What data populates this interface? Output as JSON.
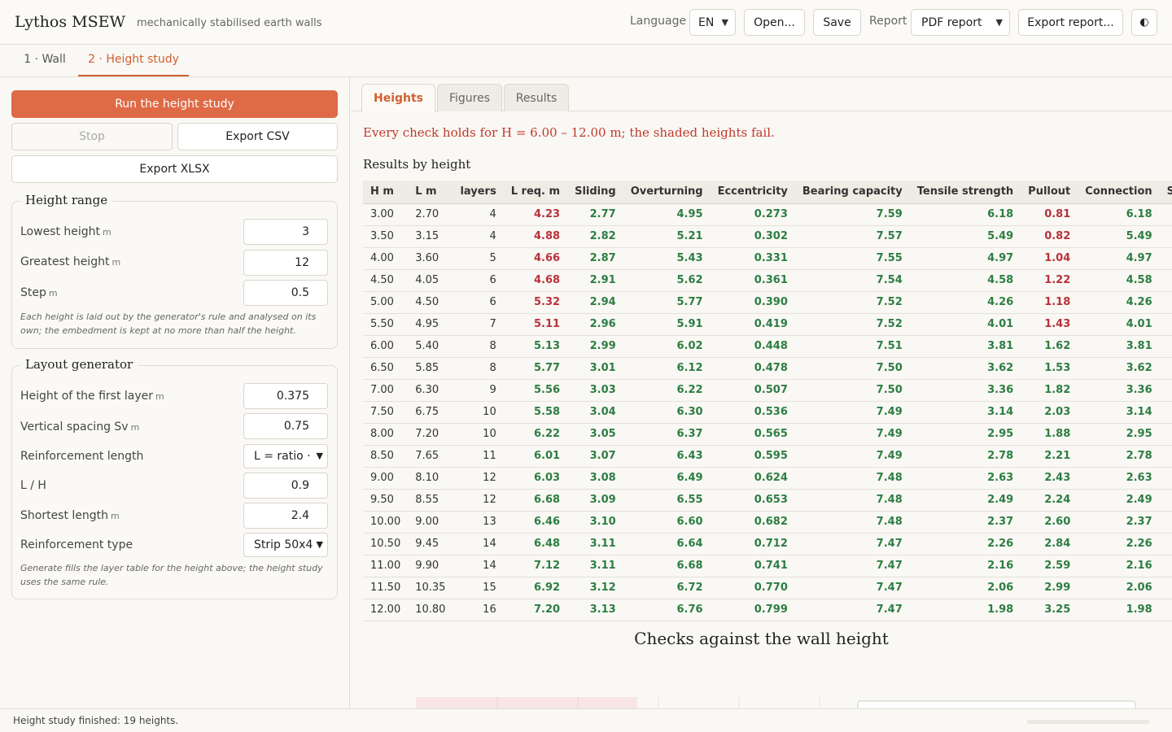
{
  "app": {
    "title": "Lythos MSEW",
    "subtitle": "mechanically stabilised earth walls"
  },
  "toolbar": {
    "language_label": "Language",
    "language_value": "EN",
    "open_label": "Open...",
    "save_label": "Save",
    "report_label": "Report",
    "report_value": "PDF report",
    "export_report_label": "Export report...",
    "theme_icon": "◐"
  },
  "steps": [
    {
      "label": "1 · Wall"
    },
    {
      "label": "2 · Height study"
    }
  ],
  "sidebar": {
    "run_label": "Run the height study",
    "stop_label": "Stop",
    "export_csv_label": "Export CSV",
    "export_xlsx_label": "Export XLSX",
    "height_range": {
      "legend": "Height range",
      "lowest_label": "Lowest height",
      "lowest_value": "3",
      "greatest_label": "Greatest height",
      "greatest_value": "12",
      "step_label": "Step",
      "step_value": "0.5",
      "unit": "m",
      "note": "Each height is laid out by the generator's rule and analysed on its own; the embedment is kept at no more than half the height."
    },
    "layout_generator": {
      "legend": "Layout generator",
      "first_layer_label": "Height of the first layer",
      "first_layer_value": "0.375",
      "spacing_label": "Vertical spacing Sv",
      "spacing_value": "0.75",
      "length_label": "Reinforcement length",
      "length_value": "L = ratio ·",
      "ratio_label": "L / H",
      "ratio_value": "0.9",
      "shortest_label": "Shortest length",
      "shortest_value": "2.4",
      "type_label": "Reinforcement type",
      "type_value": "Strip 50x4",
      "unit": "m",
      "note": "Generate fills the layer table for the height above; the height study uses the same rule."
    }
  },
  "main": {
    "tabs": [
      {
        "label": "Heights"
      },
      {
        "label": "Figures"
      },
      {
        "label": "Results"
      }
    ],
    "banner": "Every check holds for H = 6.00 – 12.00 m; the shaded heights fail.",
    "table_title": "Results by height",
    "chart_title": "Checks against the wall height"
  },
  "table": {
    "columns": [
      "H m",
      "L m",
      "layers",
      "L req. m",
      "Sliding",
      "Overturning",
      "Eccentricity",
      "Bearing capacity",
      "Tensile strength",
      "Pullout",
      "Connection",
      "Sliding"
    ],
    "rows": [
      {
        "H": "3.00",
        "L": "2.70",
        "layers": "4",
        "Lreq": "4.23",
        "sliding": "2.77",
        "overturning": "4.95",
        "ecc": "0.273",
        "bearing": "7.59",
        "tensile": "6.18",
        "pullout": "0.81",
        "connection": "6.18",
        "fail": true,
        "lreq_fail": true,
        "pullout_fail": true
      },
      {
        "H": "3.50",
        "L": "3.15",
        "layers": "4",
        "Lreq": "4.88",
        "sliding": "2.82",
        "overturning": "5.21",
        "ecc": "0.302",
        "bearing": "7.57",
        "tensile": "5.49",
        "pullout": "0.82",
        "connection": "5.49",
        "fail": true,
        "lreq_fail": true,
        "pullout_fail": true
      },
      {
        "H": "4.00",
        "L": "3.60",
        "layers": "5",
        "Lreq": "4.66",
        "sliding": "2.87",
        "overturning": "5.43",
        "ecc": "0.331",
        "bearing": "7.55",
        "tensile": "4.97",
        "pullout": "1.04",
        "connection": "4.97",
        "fail": true,
        "lreq_fail": true,
        "pullout_fail": true
      },
      {
        "H": "4.50",
        "L": "4.05",
        "layers": "6",
        "Lreq": "4.68",
        "sliding": "2.91",
        "overturning": "5.62",
        "ecc": "0.361",
        "bearing": "7.54",
        "tensile": "4.58",
        "pullout": "1.22",
        "connection": "4.58",
        "fail": true,
        "lreq_fail": true,
        "pullout_fail": true
      },
      {
        "H": "5.00",
        "L": "4.50",
        "layers": "6",
        "Lreq": "5.32",
        "sliding": "2.94",
        "overturning": "5.77",
        "ecc": "0.390",
        "bearing": "7.52",
        "tensile": "4.26",
        "pullout": "1.18",
        "connection": "4.26",
        "fail": true,
        "lreq_fail": true,
        "pullout_fail": true
      },
      {
        "H": "5.50",
        "L": "4.95",
        "layers": "7",
        "Lreq": "5.11",
        "sliding": "2.96",
        "overturning": "5.91",
        "ecc": "0.419",
        "bearing": "7.52",
        "tensile": "4.01",
        "pullout": "1.43",
        "connection": "4.01",
        "fail": true,
        "lreq_fail": true,
        "pullout_fail": true
      },
      {
        "H": "6.00",
        "L": "5.40",
        "layers": "8",
        "Lreq": "5.13",
        "sliding": "2.99",
        "overturning": "6.02",
        "ecc": "0.448",
        "bearing": "7.51",
        "tensile": "3.81",
        "pullout": "1.62",
        "connection": "3.81",
        "fail": false,
        "lreq_fail": false,
        "pullout_fail": false
      },
      {
        "H": "6.50",
        "L": "5.85",
        "layers": "8",
        "Lreq": "5.77",
        "sliding": "3.01",
        "overturning": "6.12",
        "ecc": "0.478",
        "bearing": "7.50",
        "tensile": "3.62",
        "pullout": "1.53",
        "connection": "3.62",
        "fail": false,
        "lreq_fail": false,
        "pullout_fail": false
      },
      {
        "H": "7.00",
        "L": "6.30",
        "layers": "9",
        "Lreq": "5.56",
        "sliding": "3.03",
        "overturning": "6.22",
        "ecc": "0.507",
        "bearing": "7.50",
        "tensile": "3.36",
        "pullout": "1.82",
        "connection": "3.36",
        "fail": false,
        "lreq_fail": false,
        "pullout_fail": false
      },
      {
        "H": "7.50",
        "L": "6.75",
        "layers": "10",
        "Lreq": "5.58",
        "sliding": "3.04",
        "overturning": "6.30",
        "ecc": "0.536",
        "bearing": "7.49",
        "tensile": "3.14",
        "pullout": "2.03",
        "connection": "3.14",
        "fail": false,
        "lreq_fail": false,
        "pullout_fail": false
      },
      {
        "H": "8.00",
        "L": "7.20",
        "layers": "10",
        "Lreq": "6.22",
        "sliding": "3.05",
        "overturning": "6.37",
        "ecc": "0.565",
        "bearing": "7.49",
        "tensile": "2.95",
        "pullout": "1.88",
        "connection": "2.95",
        "fail": false,
        "lreq_fail": false,
        "pullout_fail": false
      },
      {
        "H": "8.50",
        "L": "7.65",
        "layers": "11",
        "Lreq": "6.01",
        "sliding": "3.07",
        "overturning": "6.43",
        "ecc": "0.595",
        "bearing": "7.49",
        "tensile": "2.78",
        "pullout": "2.21",
        "connection": "2.78",
        "fail": false,
        "lreq_fail": false,
        "pullout_fail": false
      },
      {
        "H": "9.00",
        "L": "8.10",
        "layers": "12",
        "Lreq": "6.03",
        "sliding": "3.08",
        "overturning": "6.49",
        "ecc": "0.624",
        "bearing": "7.48",
        "tensile": "2.63",
        "pullout": "2.43",
        "connection": "2.63",
        "fail": false,
        "lreq_fail": false,
        "pullout_fail": false
      },
      {
        "H": "9.50",
        "L": "8.55",
        "layers": "12",
        "Lreq": "6.68",
        "sliding": "3.09",
        "overturning": "6.55",
        "ecc": "0.653",
        "bearing": "7.48",
        "tensile": "2.49",
        "pullout": "2.24",
        "connection": "2.49",
        "fail": false,
        "lreq_fail": false,
        "pullout_fail": false
      },
      {
        "H": "10.00",
        "L": "9.00",
        "layers": "13",
        "Lreq": "6.46",
        "sliding": "3.10",
        "overturning": "6.60",
        "ecc": "0.682",
        "bearing": "7.48",
        "tensile": "2.37",
        "pullout": "2.60",
        "connection": "2.37",
        "fail": false,
        "lreq_fail": false,
        "pullout_fail": false
      },
      {
        "H": "10.50",
        "L": "9.45",
        "layers": "14",
        "Lreq": "6.48",
        "sliding": "3.11",
        "overturning": "6.64",
        "ecc": "0.712",
        "bearing": "7.47",
        "tensile": "2.26",
        "pullout": "2.84",
        "connection": "2.26",
        "fail": false,
        "lreq_fail": false,
        "pullout_fail": false
      },
      {
        "H": "11.00",
        "L": "9.90",
        "layers": "14",
        "Lreq": "7.12",
        "sliding": "3.11",
        "overturning": "6.68",
        "ecc": "0.741",
        "bearing": "7.47",
        "tensile": "2.16",
        "pullout": "2.59",
        "connection": "2.16",
        "fail": false,
        "lreq_fail": false,
        "pullout_fail": false
      },
      {
        "H": "11.50",
        "L": "10.35",
        "layers": "15",
        "Lreq": "6.92",
        "sliding": "3.12",
        "overturning": "6.72",
        "ecc": "0.770",
        "bearing": "7.47",
        "tensile": "2.06",
        "pullout": "2.99",
        "connection": "2.06",
        "fail": false,
        "lreq_fail": false,
        "pullout_fail": false
      },
      {
        "H": "12.00",
        "L": "10.80",
        "layers": "16",
        "Lreq": "7.20",
        "sliding": "3.13",
        "overturning": "6.76",
        "ecc": "0.799",
        "bearing": "7.47",
        "tensile": "1.98",
        "pullout": "3.25",
        "connection": "1.98",
        "fail": false,
        "lreq_fail": false,
        "pullout_fail": false
      }
    ]
  },
  "status": {
    "text": "Height study finished: 19 heights.",
    "progress": 1.0
  },
  "colors": {
    "accent": "#df6a46",
    "ok": "#2e7d43",
    "fail": "#b8323b",
    "banner": "#c0392b"
  }
}
